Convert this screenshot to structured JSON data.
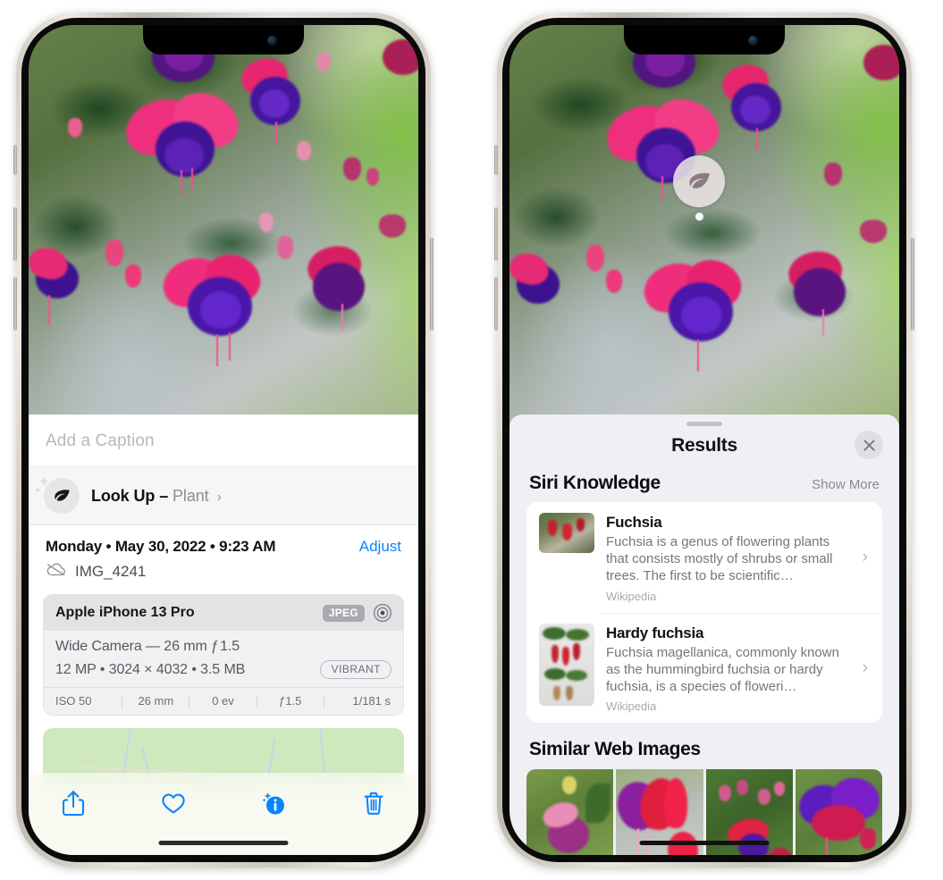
{
  "colors": {
    "accent_blue": "#0a84ff",
    "sheet_bg": "#f0eff4",
    "card_bg": "#ffffff",
    "exif_header_bg": "#e3e3e6",
    "toolbar_bg": "#f8faf2"
  },
  "left_phone": {
    "caption": {
      "placeholder": "Add a Caption",
      "value": ""
    },
    "lookup": {
      "label": "Look Up –",
      "subject": "Plant",
      "icon": "leaf-icon",
      "chevron": "›"
    },
    "metadata": {
      "date_line": "Monday • May 30, 2022 • 9:23 AM",
      "adjust_label": "Adjust",
      "filename": "IMG_4241",
      "cloud_icon": "icloud-slash-icon"
    },
    "exif": {
      "device": "Apple iPhone 13 Pro",
      "format_chip": "JPEG",
      "raw_icon": "raw-circle-icon",
      "lens": "Wide Camera — 26 mm ƒ 1.5",
      "size_line": "12 MP • 3024 × 4032 • 3.5 MB",
      "style_chip": "VIBRANT",
      "stats": [
        "ISO 50",
        "26 mm",
        "0 ev",
        "ƒ1.5",
        "1/181 s"
      ]
    },
    "toolbar": [
      {
        "name": "share-button",
        "icon": "share-icon"
      },
      {
        "name": "favorite-button",
        "icon": "heart-icon"
      },
      {
        "name": "info-button",
        "icon": "info-sparkle-icon"
      },
      {
        "name": "delete-button",
        "icon": "trash-icon"
      }
    ]
  },
  "right_phone": {
    "badge": {
      "icon": "leaf-icon"
    },
    "sheet": {
      "title": "Results",
      "close_icon": "close-icon"
    },
    "siri_knowledge": {
      "title": "Siri Knowledge",
      "action": "Show More",
      "items": [
        {
          "title": "Fuchsia",
          "description": "Fuchsia is a genus of flowering plants that consists mostly of shrubs or small trees. The first to be scientific…",
          "source": "Wikipedia",
          "chevron": "›"
        },
        {
          "title": "Hardy fuchsia",
          "description": "Fuchsia magellanica, commonly known as the hummingbird fuchsia or hardy fuchsia, is a species of floweri…",
          "source": "Wikipedia",
          "chevron": "›"
        }
      ]
    },
    "similar_web_images": {
      "title": "Similar Web Images",
      "tiles": [
        "web-image-1",
        "web-image-2",
        "web-image-3",
        "web-image-4"
      ]
    }
  }
}
